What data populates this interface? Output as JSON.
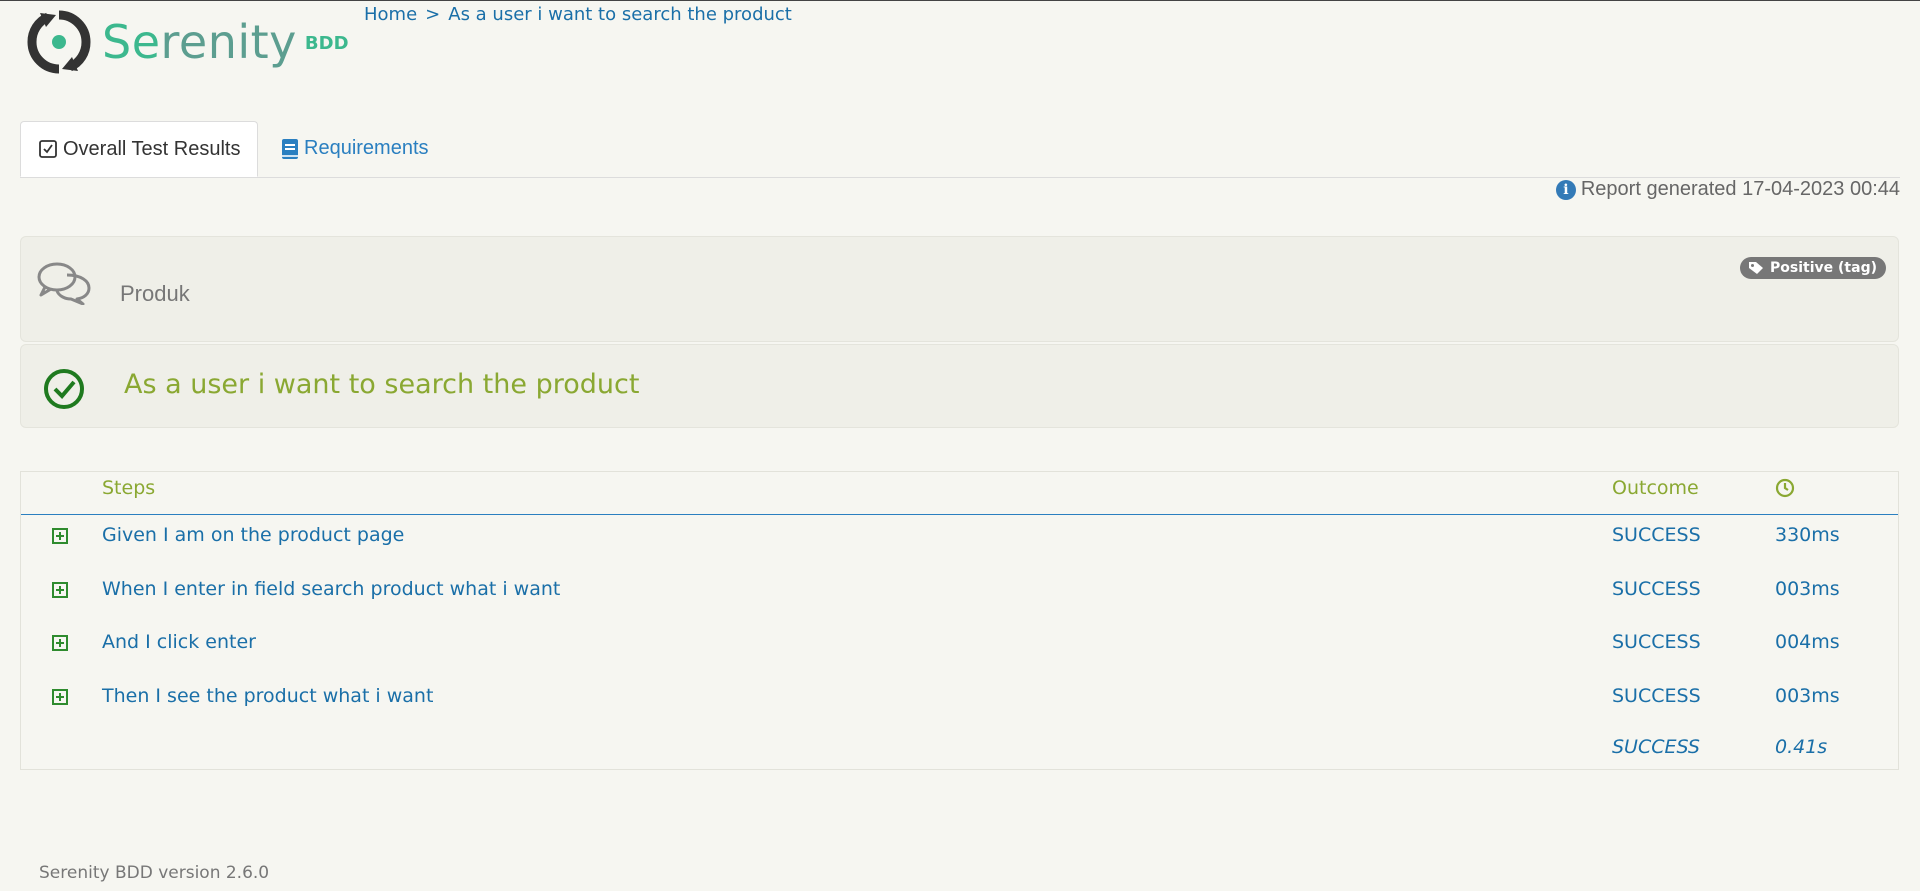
{
  "header": {
    "logo_text_se": "Se",
    "logo_text_renity": "renity",
    "logo_suffix": "BDD",
    "breadcrumb": {
      "home": "Home",
      "separator": ">",
      "current": "As a user i want to search the product"
    }
  },
  "tabs": [
    {
      "label": "Overall Test Results",
      "icon": "checkbox-icon",
      "active": true
    },
    {
      "label": "Requirements",
      "icon": "book-icon",
      "active": false
    }
  ],
  "report": {
    "generated": "Report generated 17-04-2023 00:44"
  },
  "feature": {
    "title": "Produk",
    "tag": "Positive (tag)"
  },
  "story": {
    "title": "As a user i want to search the product",
    "status_icon": "check-circle-icon"
  },
  "steps_table": {
    "headers": {
      "steps": "Steps",
      "outcome": "Outcome",
      "time_icon": "clock-icon"
    },
    "rows": [
      {
        "step": "Given I am on the product page",
        "outcome": "SUCCESS",
        "duration": "330ms"
      },
      {
        "step": "When I enter in field search product what i want",
        "outcome": "SUCCESS",
        "duration": "003ms"
      },
      {
        "step": "And I click enter",
        "outcome": "SUCCESS",
        "duration": "004ms"
      },
      {
        "step": "Then I see the product what i want",
        "outcome": "SUCCESS",
        "duration": "003ms"
      }
    ],
    "total": {
      "outcome": "SUCCESS",
      "duration": "0.41s"
    }
  },
  "footer": {
    "version": "Serenity BDD version 2.6.0"
  },
  "colors": {
    "accent_green": "#8aa832",
    "link_blue": "#1a6fa8",
    "brand_green": "#3cb88e",
    "success_green": "#2e8b2e"
  }
}
